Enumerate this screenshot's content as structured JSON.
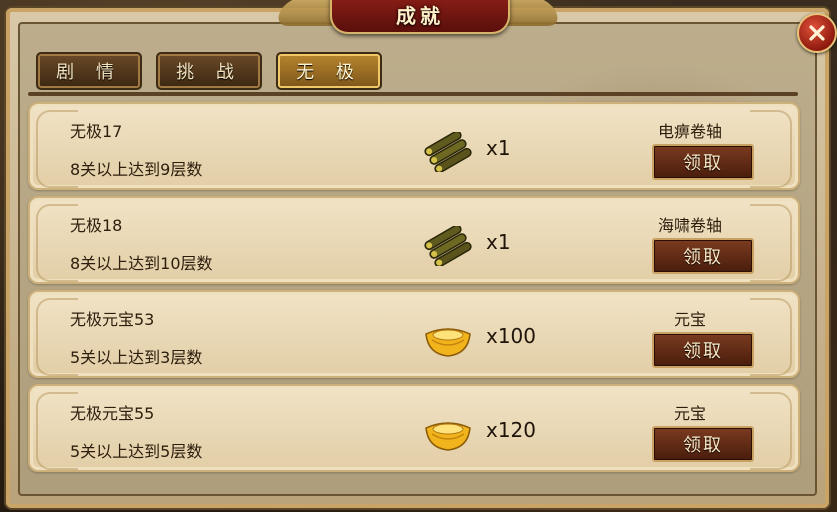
{
  "title": "成就",
  "tabs": [
    {
      "label": "剧 情"
    },
    {
      "label": "挑 战"
    },
    {
      "label": "无 极"
    }
  ],
  "active_tab": 2,
  "achievements": [
    {
      "name": "无极17",
      "desc": "8关以上达到9层数",
      "reward_icon": "scroll-bundle-icon",
      "qty": "x1",
      "reward_name": "电痹卷轴",
      "button": "领取"
    },
    {
      "name": "无极18",
      "desc": "8关以上达到10层数",
      "reward_icon": "scroll-bundle-icon",
      "qty": "x1",
      "reward_name": "海啸卷轴",
      "button": "领取"
    },
    {
      "name": "无极元宝53",
      "desc": "5关以上达到3层数",
      "reward_icon": "gold-ingot-icon",
      "qty": "x100",
      "reward_name": "元宝",
      "button": "领取"
    },
    {
      "name": "无极元宝55",
      "desc": "5关以上达到5层数",
      "reward_icon": "gold-ingot-icon",
      "qty": "x120",
      "reward_name": "元宝",
      "button": "领取"
    }
  ],
  "colors": {
    "title_banner": "#7a1a12",
    "button": "#5e2812",
    "row_bg": "#ead9b6",
    "frame": "#b7a682"
  }
}
